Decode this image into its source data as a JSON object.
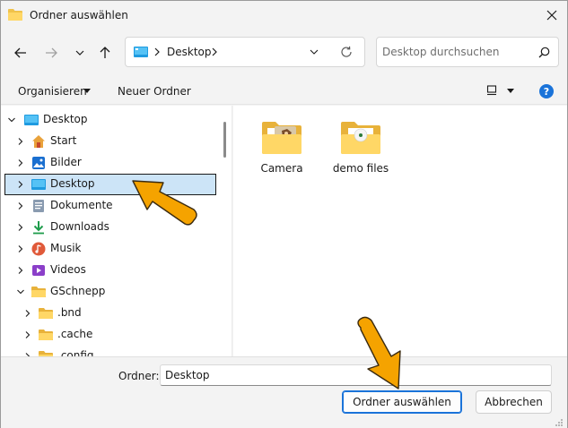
{
  "window": {
    "title": "Ordner auswählen"
  },
  "nav": {
    "address_crumb": "Desktop",
    "search_placeholder": "Desktop durchsuchen"
  },
  "toolbar": {
    "organize_label": "Organisieren",
    "new_folder_label": "Neuer Ordner",
    "help_label": "?"
  },
  "tree": {
    "items": [
      {
        "label": "Desktop",
        "icon": "desktop-icon",
        "expanded": true
      },
      {
        "label": "Start",
        "icon": "home-icon"
      },
      {
        "label": "Bilder",
        "icon": "pictures-icon"
      },
      {
        "label": "Desktop",
        "icon": "desktop-icon",
        "selected": true
      },
      {
        "label": "Dokumente",
        "icon": "documents-icon"
      },
      {
        "label": "Downloads",
        "icon": "download-icon"
      },
      {
        "label": "Musik",
        "icon": "music-icon"
      },
      {
        "label": "Videos",
        "icon": "videos-icon"
      },
      {
        "label": "GSchnepp",
        "icon": "folder-icon",
        "expanded": true
      },
      {
        "label": ".bnd",
        "icon": "folder-icon"
      },
      {
        "label": ".cache",
        "icon": "folder-icon"
      },
      {
        "label": ".config",
        "icon": "folder-icon"
      }
    ]
  },
  "content": {
    "folders": [
      {
        "label": "Camera",
        "icon": "folder-camera-icon"
      },
      {
        "label": "demo files",
        "icon": "folder-disc-icon"
      }
    ]
  },
  "footer": {
    "folder_label": "Ordner:",
    "folder_value": "Desktop",
    "select_button": "Ordner auswählen",
    "cancel_button": "Abbrechen"
  },
  "colors": {
    "accent": "#1a73d9",
    "selection": "#cce4f7",
    "annotation_arrow": "#f5a300"
  }
}
